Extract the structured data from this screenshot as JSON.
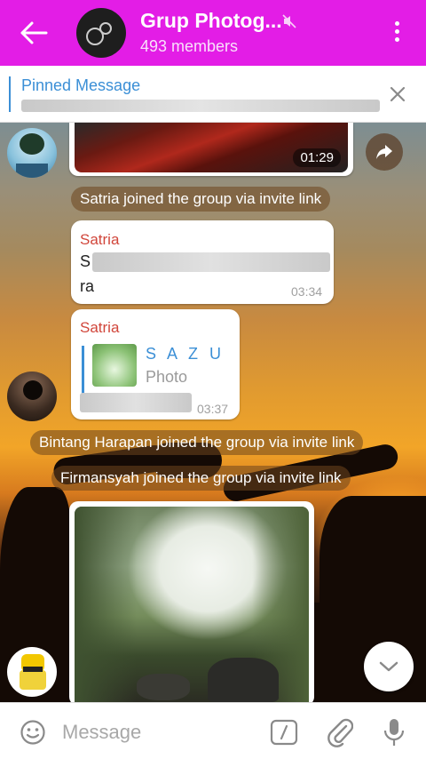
{
  "header": {
    "title": "Grup Photog...",
    "members": "493 members"
  },
  "pinned": {
    "label": "Pinned Message"
  },
  "messages": {
    "photo_top_time": "01:29",
    "service_1": "Satria joined the group via invite link",
    "msg1": {
      "sender": "Satria",
      "text_line1": "S",
      "text_line2": "ra",
      "time": "03:34"
    },
    "msg2": {
      "sender": "Satria",
      "fwd_name": "S A Z U",
      "fwd_type": "Photo",
      "time": "03:37"
    },
    "service_2": "Bintang Harapan joined the group via invite link",
    "service_3": "Firmansyah joined the group via invite link"
  },
  "input": {
    "placeholder": "Message"
  },
  "colors": {
    "header_bg": "#e31de6",
    "accent_blue": "#3b8fd6",
    "sender_red": "#d1463b"
  },
  "icons": [
    "back-arrow-icon",
    "mute-icon",
    "more-vert-icon",
    "close-icon",
    "share-icon",
    "chevron-down-icon",
    "emoji-icon",
    "command-icon",
    "attach-icon",
    "mic-icon"
  ]
}
